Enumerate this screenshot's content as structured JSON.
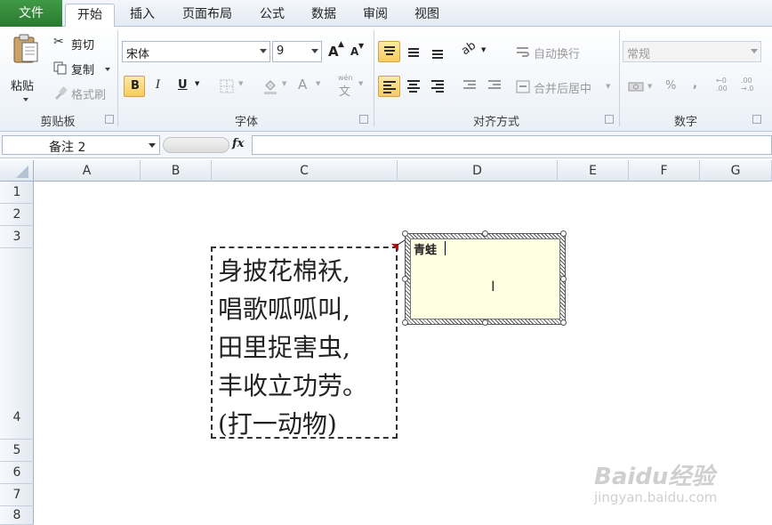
{
  "tabs": {
    "file": "文件",
    "items": [
      "开始",
      "插入",
      "页面布局",
      "公式",
      "数据",
      "审阅",
      "视图"
    ],
    "active_index": 0
  },
  "clipboard": {
    "paste": "粘贴",
    "cut": "剪切",
    "copy": "复制",
    "format_painter": "格式刷",
    "group_label": "剪贴板"
  },
  "font": {
    "name": "宋体",
    "size": "9",
    "bold": "B",
    "italic": "I",
    "underline": "U",
    "grow": "A",
    "shrink": "A",
    "font_color": "A",
    "phonetic": "wén",
    "group_label": "字体"
  },
  "alignment": {
    "wrap_text": "自动换行",
    "merge_center": "合并后居中",
    "group_label": "对齐方式"
  },
  "number": {
    "format": "常规",
    "percent": "%",
    "comma": ",",
    "group_label": "数字"
  },
  "formula_bar": {
    "name_box": "备注 2",
    "fx": "fx",
    "content": ""
  },
  "columns": [
    "A",
    "B",
    "C",
    "D",
    "E",
    "F",
    "G"
  ],
  "rows": [
    "1",
    "2",
    "3",
    "4",
    "5",
    "6",
    "7",
    "8"
  ],
  "cell_text": {
    "lines": [
      "身披花棉袄,",
      "唱歌呱呱叫,",
      "田里捉害虫,",
      "丰收立功劳。",
      "(打一动物)"
    ]
  },
  "comment": {
    "text": "青蛙"
  },
  "watermark": {
    "logo": "Baidu经验",
    "url": "jingyan.baidu.com"
  }
}
